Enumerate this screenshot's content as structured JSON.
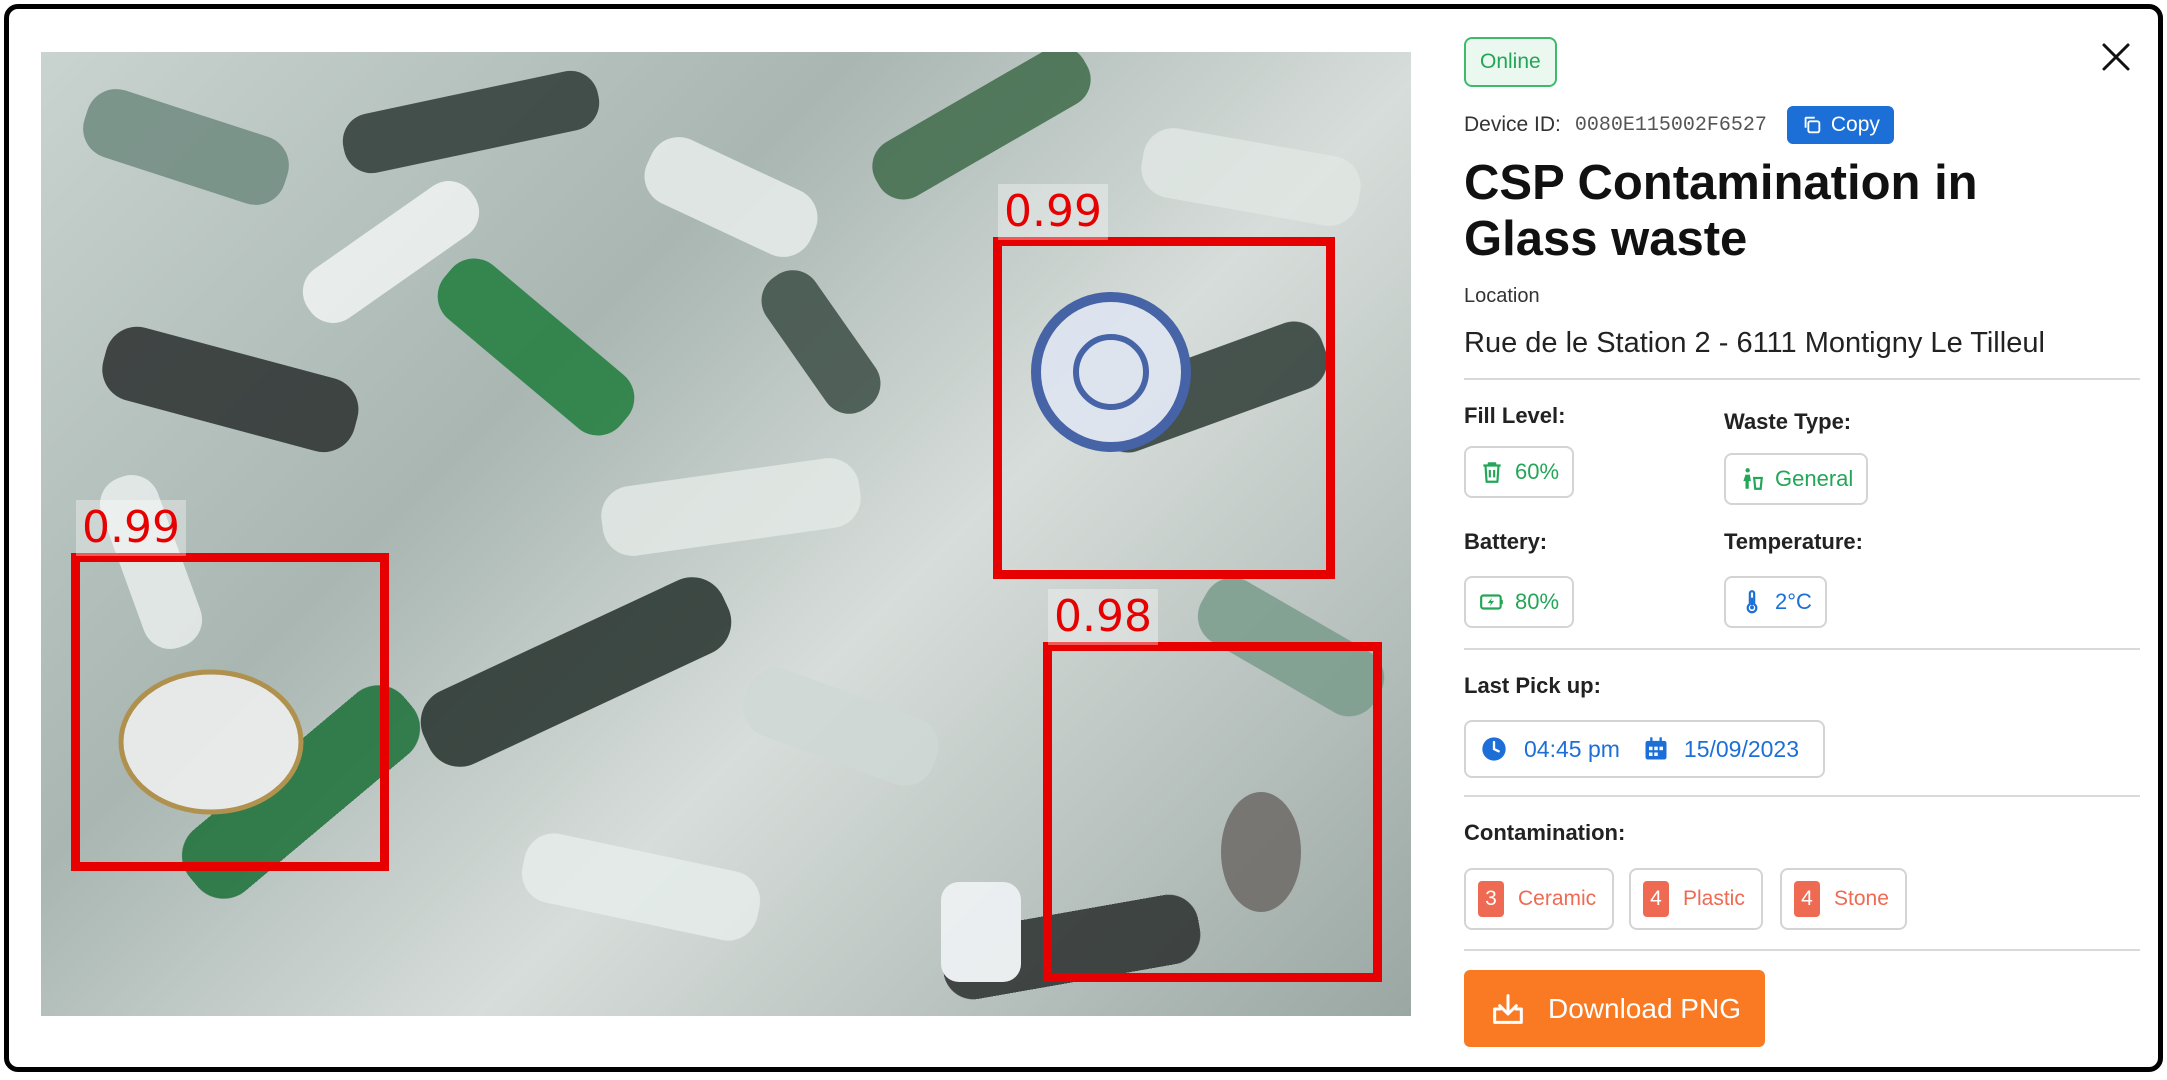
{
  "image": {
    "alt_icon": "waste-photo",
    "detections": [
      {
        "score": "0.99"
      },
      {
        "score": "0.99"
      },
      {
        "score": "0.98"
      }
    ]
  },
  "panel": {
    "status": "Online",
    "device_label": "Device ID:",
    "device_id": "0080E115002F6527",
    "copy_label": "Copy",
    "title": "CSP Contamination in Glass waste",
    "location_label": "Location",
    "location_value": "Rue de le Station 2 - 6111 Montigny Le Tilleul",
    "fill_level_label": "Fill Level:",
    "fill_level_value": "60%",
    "fill_level_fraction": 0.6,
    "waste_type_label": "Waste Type:",
    "waste_type_value": "General",
    "battery_label": "Battery:",
    "battery_value": "80%",
    "battery_fraction": 0.8,
    "temperature_label": "Temperature:",
    "temperature_value": "2°C",
    "last_pickup_label": "Last Pick up:",
    "last_pickup_time": "04:45 pm",
    "last_pickup_date": "15/09/2023",
    "contamination_label": "Contamination:",
    "contamination": [
      {
        "count": "3",
        "label": "Ceramic"
      },
      {
        "count": "4",
        "label": "Plastic"
      },
      {
        "count": "4",
        "label": "Stone"
      }
    ],
    "download_label": "Download PNG"
  },
  "colors": {
    "status_green": "#23a657",
    "accent_blue": "#1c6fd6",
    "detection_red": "#e60000",
    "contamination_red": "#ef6a52",
    "download_orange": "#fa7a24"
  },
  "icons": {
    "close": "close-icon",
    "copy": "copy-icon",
    "fill_level": "trash-icon",
    "waste_type": "recycle-person-icon",
    "battery": "battery-charging-icon",
    "temperature": "thermometer-icon",
    "time": "clock-icon",
    "date": "calendar-icon",
    "download": "download-icon"
  }
}
